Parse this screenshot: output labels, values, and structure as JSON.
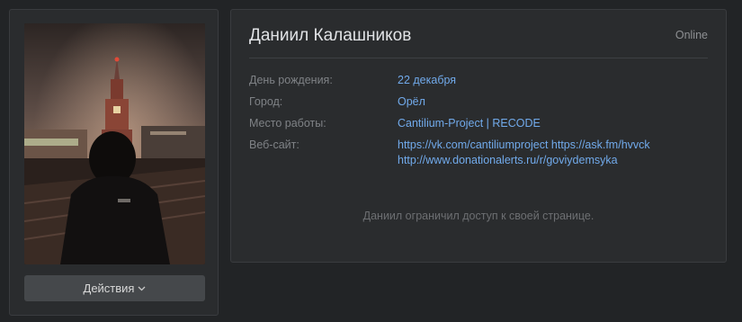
{
  "profile": {
    "name": "Даниил Калашников",
    "status": "Online",
    "actions_label": "Действия",
    "restricted_message": "Даниил ограничил доступ к своей странице."
  },
  "info": [
    {
      "label": "День рождения:",
      "value": "22 декабря"
    },
    {
      "label": "Город:",
      "value": "Орёл"
    },
    {
      "label": "Место работы:",
      "value": "Cantilium-Project | RECODE"
    }
  ],
  "website": {
    "label": "Веб-сайт:",
    "line1": "https://vk.com/cantiliumproject https://ask.fm/hvvck",
    "line2": "http://www.donationalerts.ru/r/goviydemsyka"
  },
  "icons": {
    "dropdown": "chevron-down-icon"
  },
  "colors": {
    "background": "#222426",
    "card": "#2a2c2e",
    "link": "#71aaeb",
    "label": "#7f8286",
    "button": "#45484b"
  }
}
